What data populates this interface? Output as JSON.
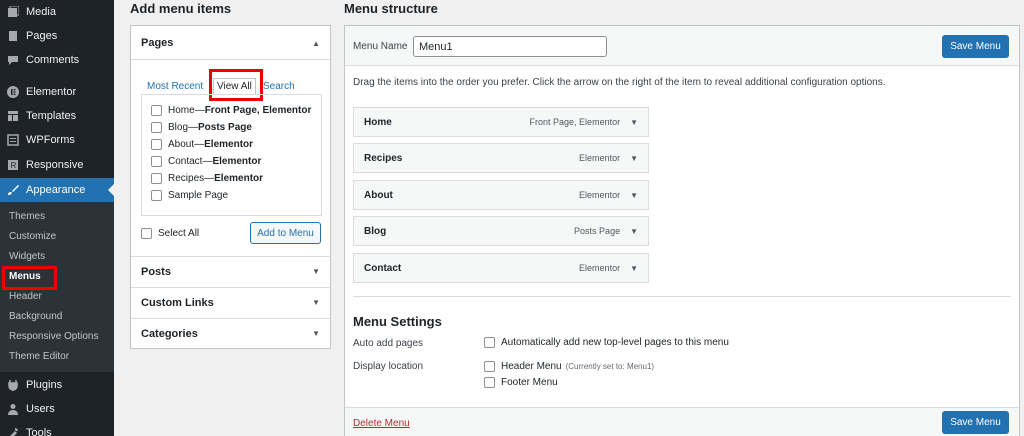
{
  "sidebar": {
    "items": [
      {
        "label": "Media",
        "icon": "media-icon"
      },
      {
        "label": "Pages",
        "icon": "pages-icon"
      },
      {
        "label": "Comments",
        "icon": "comments-icon"
      },
      {
        "label": "Elementor",
        "icon": "elementor-icon"
      },
      {
        "label": "Templates",
        "icon": "templates-icon"
      },
      {
        "label": "WPForms",
        "icon": "wpforms-icon"
      },
      {
        "label": "Responsive",
        "icon": "responsive-icon"
      },
      {
        "label": "Appearance",
        "icon": "appearance-brush-icon"
      },
      {
        "label": "Plugins",
        "icon": "plugins-icon"
      },
      {
        "label": "Users",
        "icon": "users-icon"
      },
      {
        "label": "Tools",
        "icon": "tools-icon"
      }
    ],
    "submenu": [
      "Themes",
      "Customize",
      "Widgets",
      "Menus",
      "Header",
      "Background",
      "Responsive Options",
      "Theme Editor"
    ]
  },
  "add_items": {
    "heading": "Add menu items",
    "pages_title": "Pages",
    "tabs": {
      "recent": "Most Recent",
      "all": "View All",
      "search": "Search"
    },
    "pages": [
      {
        "name": "Home",
        "sep": " — ",
        "tag": "Front Page, Elementor"
      },
      {
        "name": "Blog",
        "sep": " — ",
        "tag": "Posts Page"
      },
      {
        "name": "About",
        "sep": " — ",
        "tag": "Elementor"
      },
      {
        "name": "Contact",
        "sep": " — ",
        "tag": "Elementor"
      },
      {
        "name": "Recipes",
        "sep": " — ",
        "tag": "Elementor"
      },
      {
        "name": "Sample Page",
        "sep": "",
        "tag": ""
      }
    ],
    "select_all": "Select All",
    "add_button": "Add to Menu",
    "sections": [
      "Posts",
      "Custom Links",
      "Categories"
    ]
  },
  "structure": {
    "heading": "Menu structure",
    "name_label": "Menu Name",
    "name_value": "Menu1",
    "save": "Save Menu",
    "instructions": "Drag the items into the order you prefer. Click the arrow on the right of the item to reveal additional configuration options.",
    "items": [
      {
        "title": "Home",
        "type": "Front Page, Elementor"
      },
      {
        "title": "Recipes",
        "type": "Elementor"
      },
      {
        "title": "About",
        "type": "Elementor"
      },
      {
        "title": "Blog",
        "type": "Posts Page"
      },
      {
        "title": "Contact",
        "type": "Elementor"
      }
    ],
    "settings_heading": "Menu Settings",
    "auto_label": "Auto add pages",
    "auto_option": "Automatically add new top-level pages to this menu",
    "display_label": "Display location",
    "header_option": "Header Menu",
    "header_note": "(Currently set to: Menu1)",
    "footer_option": "Footer Menu",
    "delete": "Delete Menu"
  }
}
